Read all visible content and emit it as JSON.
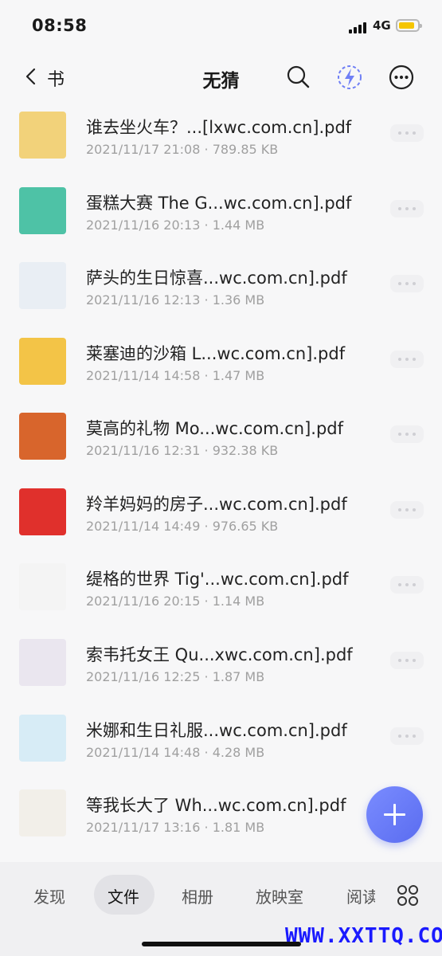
{
  "status": {
    "time": "08:58",
    "network": "4G"
  },
  "nav": {
    "back_label": "书",
    "title": "无猜"
  },
  "files": [
    {
      "name": "谁去坐火车？...[lxwc.com.cn].pdf",
      "date": "2021/11/17 21:08",
      "size": "789.85 KB",
      "thumb": "#f2d27a"
    },
    {
      "name": "蛋糕大赛 The G...wc.com.cn].pdf",
      "date": "2021/11/16 20:13",
      "size": "1.44 MB",
      "thumb": "#4ec2a6"
    },
    {
      "name": "萨头的生日惊喜...wc.com.cn].pdf",
      "date": "2021/11/16 12:13",
      "size": "1.36 MB",
      "thumb": "#e9eef4"
    },
    {
      "name": "莱塞迪的沙箱 L...wc.com.cn].pdf",
      "date": "2021/11/14 14:58",
      "size": "1.47 MB",
      "thumb": "#f3c447"
    },
    {
      "name": "莫高的礼物 Mo...wc.com.cn].pdf",
      "date": "2021/11/16 12:31",
      "size": "932.38 KB",
      "thumb": "#d8652c"
    },
    {
      "name": "羚羊妈妈的房子...wc.com.cn].pdf",
      "date": "2021/11/14 14:49",
      "size": "976.65 KB",
      "thumb": "#e0302c"
    },
    {
      "name": "缇格的世界 Tig'...wc.com.cn].pdf",
      "date": "2021/11/16 20:15",
      "size": "1.14 MB",
      "thumb": "#f4f4f4"
    },
    {
      "name": "索韦托女王 Qu...xwc.com.cn].pdf",
      "date": "2021/11/16 12:25",
      "size": "1.87 MB",
      "thumb": "#eae6ef"
    },
    {
      "name": "米娜和生日礼服...wc.com.cn].pdf",
      "date": "2021/11/14 14:48",
      "size": "4.28 MB",
      "thumb": "#d7ecf6"
    },
    {
      "name": "等我长大了 Wh...wc.com.cn].pdf",
      "date": "2021/11/17 13:16",
      "size": "1.81 MB",
      "thumb": "#f2efe9"
    }
  ],
  "tabs": [
    {
      "label": "发现"
    },
    {
      "label": "文件"
    },
    {
      "label": "相册"
    },
    {
      "label": "放映室"
    },
    {
      "label": "阅读"
    }
  ],
  "meta_separator": " · ",
  "watermark": "WWW.XXTTQ.COM",
  "icons": [
    "chevron-left-icon",
    "search-icon",
    "flash-icon",
    "more-circle-icon",
    "more-dots-icon",
    "plus-icon",
    "grid-icon"
  ],
  "colors": {
    "accent": "#5a6cf0",
    "battery": "#f5c500"
  }
}
